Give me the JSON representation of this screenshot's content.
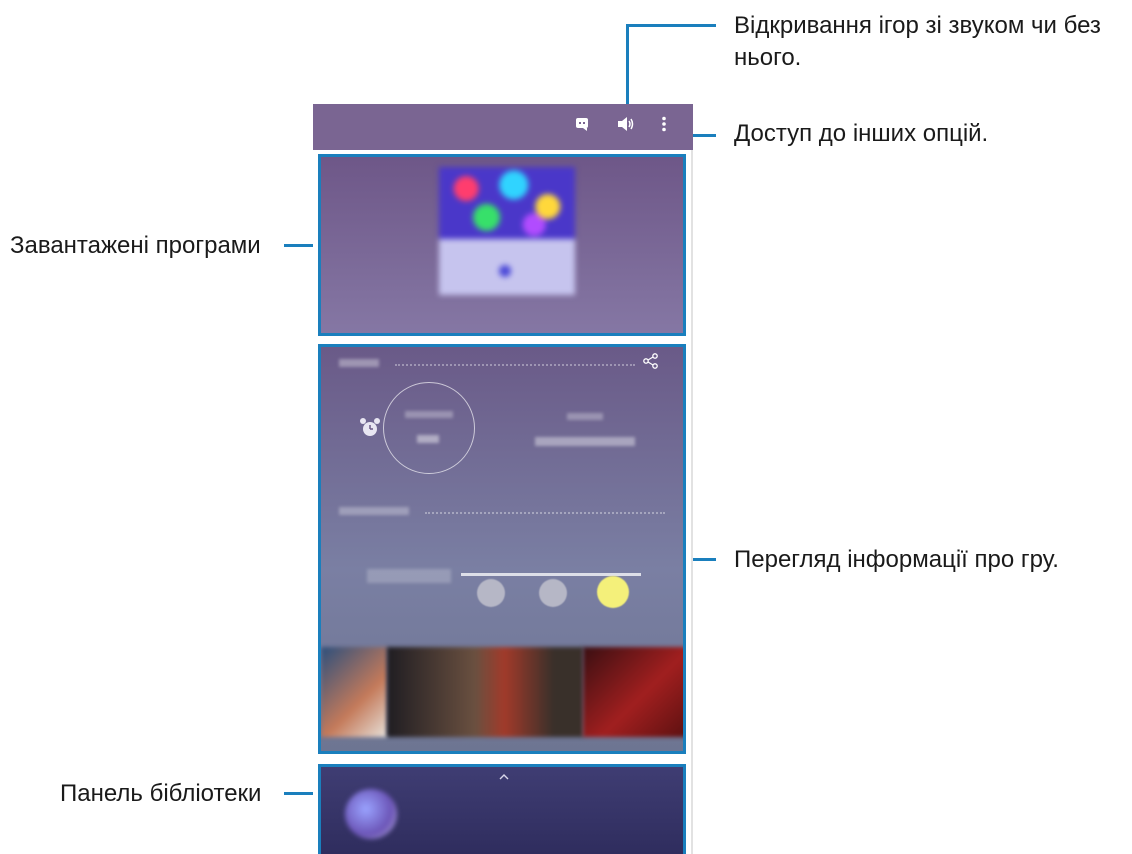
{
  "callouts": {
    "sound": "Відкривання ігор зі звуком чи без нього.",
    "sound_line1": "Відкривання ігор зі звуком чи без",
    "sound_line2": "нього.",
    "options": "Доступ до інших опцій.",
    "downloaded": "Завантажені програми",
    "info": "Перегляд інформації про гру.",
    "library": "Панель бібліотеки"
  },
  "icons": {
    "discord": "discord-icon",
    "sound": "speaker-icon",
    "more": "more-options-icon",
    "share": "share-icon",
    "alarm": "alarm-clock-icon",
    "caret": "chevron-up-icon"
  },
  "colors": {
    "callout_line": "#1a7fbd",
    "topbar": "#7a6592",
    "slider_active": "#f4f07a"
  }
}
